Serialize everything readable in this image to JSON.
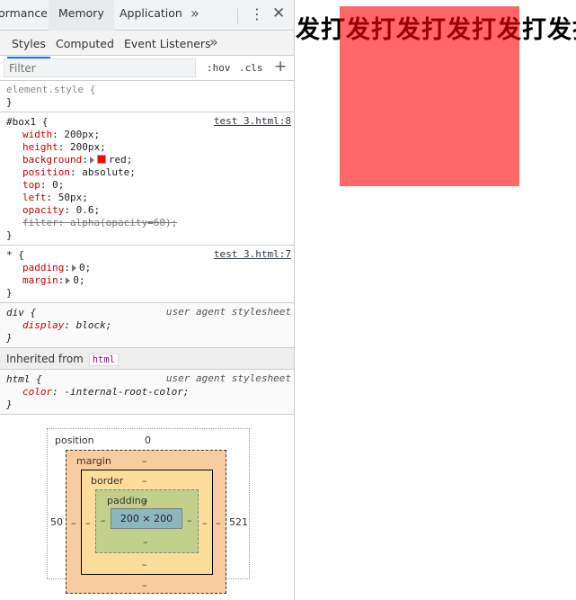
{
  "devtools": {
    "tabs": [
      {
        "label": "ormance"
      },
      {
        "label": "Memory"
      },
      {
        "label": "Application"
      }
    ],
    "more_tabs_icon": "»",
    "kebab_icon": "⋮",
    "close_icon": "✕",
    "subtabs": [
      {
        "label": "Styles"
      },
      {
        "label": "Computed"
      },
      {
        "label": "Event Listeners"
      }
    ],
    "subtabs_more_icon": "»",
    "filter": {
      "placeholder": "Filter",
      "hov": ":hov",
      "cls": ".cls",
      "plus": "+"
    },
    "element_style": {
      "selector": "element.style {",
      "close": "}"
    },
    "rules": [
      {
        "selector": "#box1 {",
        "source": "test 3.html:8",
        "decls": [
          {
            "name": "width",
            "value": " 200px;"
          },
          {
            "name": "height",
            "value": " 200px;"
          },
          {
            "name": "background",
            "value": "red;",
            "swatch": "#ff0000"
          },
          {
            "name": "position",
            "value": " absolute;"
          },
          {
            "name": "top",
            "value": " 0;"
          },
          {
            "name": "left",
            "value": " 50px;"
          },
          {
            "name": "opacity",
            "value": " 0.6;"
          },
          {
            "name": "filter",
            "value": " alpha(opacity=60);",
            "struck": true
          }
        ]
      },
      {
        "selector": "* {",
        "source": "test 3.html:7",
        "decls": [
          {
            "name": "padding",
            "value": "0;"
          },
          {
            "name": "margin",
            "value": "0;"
          }
        ]
      },
      {
        "selector": "div {",
        "source": "user agent stylesheet",
        "decls": [
          {
            "name": "display",
            "value": " block;"
          }
        ]
      }
    ],
    "inherited": {
      "label": "Inherited from",
      "tag": "html"
    },
    "html_rule": {
      "selector": "html {",
      "source": "user agent stylesheet",
      "decl_name": "color",
      "decl_value": " -internal-root-color;"
    },
    "close_brace": "}",
    "colon": ":",
    "box_model": {
      "position_label": "position",
      "position_top": "0",
      "margin_label": "margin",
      "border_label": "border",
      "padding_label": "padding",
      "content": "200 × 200",
      "left_value": "50",
      "right_value": "521",
      "dash": "–"
    }
  },
  "page": {
    "text": "发打发打发打发打发打发打发打发打",
    "box_color": "#ff0000"
  }
}
